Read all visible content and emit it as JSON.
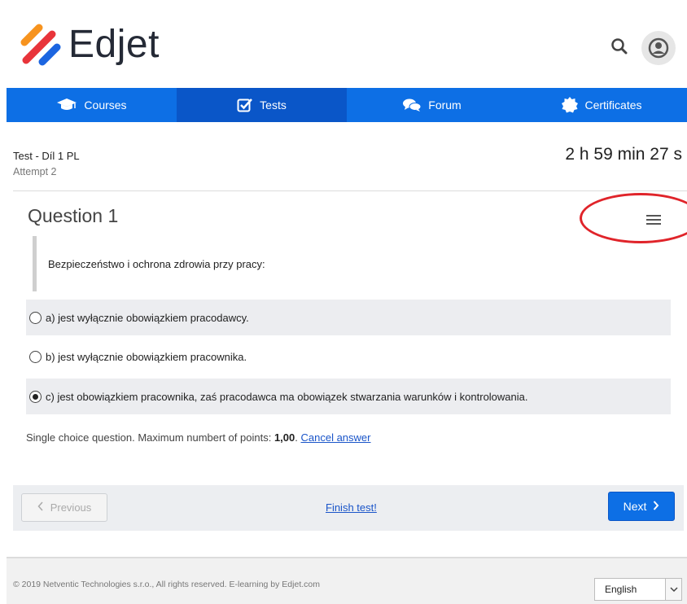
{
  "brand": {
    "name": "Edjet",
    "colors": {
      "orange": "#f7931e",
      "red": "#e8343a",
      "blue": "#1c65e0",
      "text": "#252a36"
    }
  },
  "header": {
    "search_icon": "search-icon",
    "user_icon": "user-avatar-icon"
  },
  "nav": {
    "items": [
      {
        "label": "Courses",
        "icon": "graduation-cap-icon",
        "active": false
      },
      {
        "label": "Tests",
        "icon": "checkbox-icon",
        "active": true
      },
      {
        "label": "Forum",
        "icon": "chat-bubbles-icon",
        "active": false
      },
      {
        "label": "Certificates",
        "icon": "certificate-seal-icon",
        "active": false
      }
    ],
    "colors": {
      "background": "#0d6fe5",
      "active": "#0a56c8"
    }
  },
  "test": {
    "title": "Test - Díl 1 PL",
    "attempt": "Attempt 2",
    "timer": "2 h 59 min 27 s"
  },
  "question": {
    "heading": "Question 1",
    "text": "Bezpieczeństwo i ochrona zdrowia przy pracy:",
    "options": [
      {
        "label": "a) jest wyłącznie obowiązkiem pracodawcy.",
        "selected": false
      },
      {
        "label": "b) jest wyłącznie obowiązkiem pracownika.",
        "selected": false
      },
      {
        "label": "c) jest obowiązkiem pracownika, zaś pracodawca ma obowiązek stwarzania warunków i kontrolowania.",
        "selected": true
      }
    ],
    "info_prefix": "Single choice question. Maximum numbert of points: ",
    "points": "1,00",
    "info_suffix": ".",
    "cancel_label": "Cancel answer"
  },
  "navigation": {
    "previous_label": "Previous",
    "finish_label": "Finish test!",
    "next_label": "Next"
  },
  "footer": {
    "copyright": "© 2019 Netventic Technologies s.r.o., All rights reserved. E-learning by Edjet.com",
    "language": "English"
  }
}
